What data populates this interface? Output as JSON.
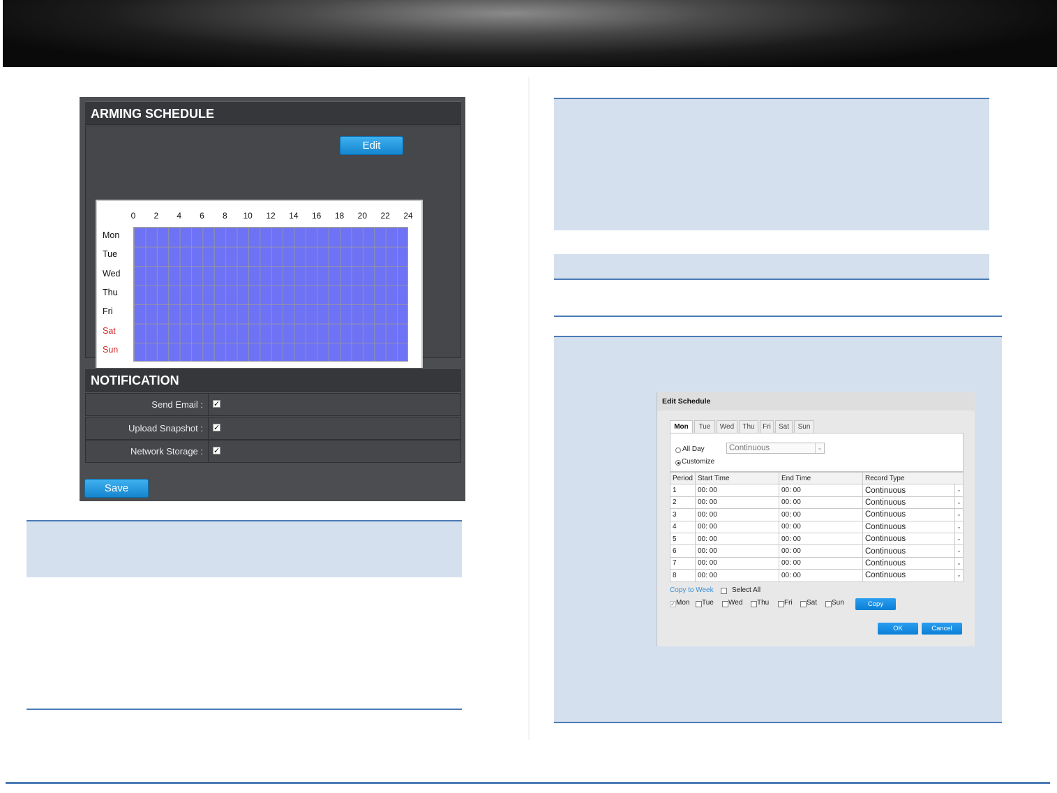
{
  "arming_schedule": {
    "title": "ARMING SCHEDULE",
    "edit_label": "Edit",
    "hours": [
      "0",
      "2",
      "4",
      "6",
      "8",
      "10",
      "12",
      "14",
      "16",
      "18",
      "20",
      "22",
      "24"
    ],
    "days": [
      {
        "label": "Mon",
        "weekend": false
      },
      {
        "label": "Tue",
        "weekend": false
      },
      {
        "label": "Wed",
        "weekend": false
      },
      {
        "label": "Thu",
        "weekend": false
      },
      {
        "label": "Fri",
        "weekend": false
      },
      {
        "label": "Sat",
        "weekend": true
      },
      {
        "label": "Sun",
        "weekend": true
      }
    ],
    "grid_color": "#6e72f5",
    "weekend_color": "#d42222"
  },
  "notification": {
    "title": "NOTIFICATION",
    "rows": [
      {
        "label": "Send Email :",
        "checked": true
      },
      {
        "label": "Upload Snapshot :",
        "checked": true
      },
      {
        "label": "Network Storage :",
        "checked": true
      }
    ],
    "save_label": "Save"
  },
  "edit_schedule": {
    "title": "Edit Schedule",
    "tabs": [
      "Mon",
      "Tue",
      "Wed",
      "Thu",
      "Fri",
      "Sat",
      "Sun"
    ],
    "active_tab": "Mon",
    "all_day_label": "All Day",
    "customize_label": "Customize",
    "selected_mode": "Customize",
    "all_day_select": "Continuous",
    "columns": [
      "Period",
      "Start Time",
      "End Time",
      "Record Type"
    ],
    "periods": [
      {
        "period": "1",
        "start": "00: 00",
        "end": "00: 00",
        "type": "Continuous"
      },
      {
        "period": "2",
        "start": "00: 00",
        "end": "00: 00",
        "type": "Continuous"
      },
      {
        "period": "3",
        "start": "00: 00",
        "end": "00: 00",
        "type": "Continuous"
      },
      {
        "period": "4",
        "start": "00: 00",
        "end": "00: 00",
        "type": "Continuous"
      },
      {
        "period": "5",
        "start": "00: 00",
        "end": "00: 00",
        "type": "Continuous"
      },
      {
        "period": "6",
        "start": "00: 00",
        "end": "00: 00",
        "type": "Continuous"
      },
      {
        "period": "7",
        "start": "00: 00",
        "end": "00: 00",
        "type": "Continuous"
      },
      {
        "period": "8",
        "start": "00: 00",
        "end": "00: 00",
        "type": "Continuous"
      }
    ],
    "copy_to_week_label": "Copy to Week",
    "select_all_label": "Select All",
    "copy_days": [
      {
        "label": "Mon",
        "checked": true
      },
      {
        "label": "Tue",
        "checked": false
      },
      {
        "label": "Wed",
        "checked": false
      },
      {
        "label": "Thu",
        "checked": false
      },
      {
        "label": "Fri",
        "checked": false
      },
      {
        "label": "Sat",
        "checked": false
      },
      {
        "label": "Sun",
        "checked": false
      }
    ],
    "copy_label": "Copy",
    "ok_label": "OK",
    "cancel_label": "Cancel"
  }
}
